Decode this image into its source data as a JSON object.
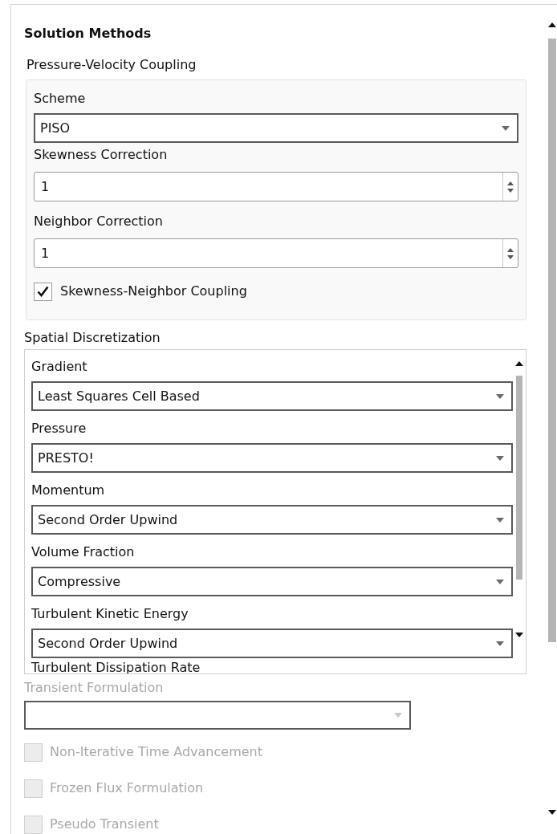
{
  "panel": {
    "title": "Solution Methods"
  },
  "pressure_velocity_coupling": {
    "title": "Pressure-Velocity Coupling",
    "fields": [
      {
        "kind": "dropdown",
        "label": "Scheme",
        "value": "PISO"
      },
      {
        "kind": "spinner",
        "label": "Skewness Correction",
        "value": "1"
      },
      {
        "kind": "spinner",
        "label": "Neighbor Correction",
        "value": "1"
      },
      {
        "kind": "checkbox",
        "label": "Skewness-Neighbor Coupling",
        "checked": true
      }
    ]
  },
  "spatial_discretization": {
    "title": "Spatial Discretization",
    "fields": [
      {
        "kind": "dropdown",
        "label": "Gradient",
        "value": "Least Squares Cell Based"
      },
      {
        "kind": "dropdown",
        "label": "Pressure",
        "value": "PRESTO!"
      },
      {
        "kind": "dropdown",
        "label": "Momentum",
        "value": "Second Order Upwind"
      },
      {
        "kind": "dropdown",
        "label": "Volume Fraction",
        "value": "Compressive"
      },
      {
        "kind": "dropdown",
        "label": "Turbulent Kinetic Energy",
        "value": "Second Order Upwind"
      },
      {
        "kind": "label",
        "label": "Turbulent Dissipation Rate"
      }
    ]
  },
  "transient_formulation": {
    "label": "Transient Formulation",
    "disabled": true
  },
  "options": [
    {
      "label": "Non-Iterative Time Advancement",
      "checked": false,
      "disabled": true
    },
    {
      "label": "Frozen Flux Formulation",
      "checked": false,
      "disabled": true
    },
    {
      "label": "Pseudo Transient",
      "checked": false,
      "disabled": true
    }
  ]
}
